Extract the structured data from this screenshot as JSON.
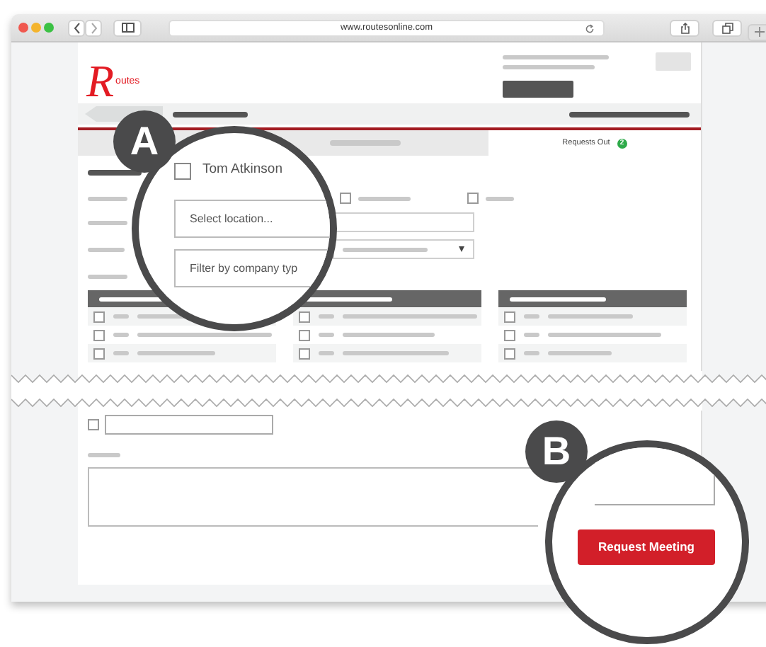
{
  "browser": {
    "url": "www.routesonline.com"
  },
  "header": {
    "logo": "Routes"
  },
  "tabs": [
    {
      "selected": false
    },
    {
      "label": "Requests Out",
      "badge": "2",
      "selected": true
    }
  ],
  "form": {
    "options": [
      {
        "checked": false
      },
      {
        "checked": false
      }
    ]
  },
  "tables": [
    {
      "rows": [
        {
          "checked": false
        },
        {
          "checked": false
        },
        {
          "checked": false
        }
      ]
    },
    {
      "rows": [
        {
          "checked": false
        },
        {
          "checked": false
        },
        {
          "checked": false
        }
      ]
    },
    {
      "rows": [
        {
          "checked": false
        },
        {
          "checked": false
        },
        {
          "checked": false
        }
      ]
    }
  ],
  "lower": {
    "option": {
      "checked": false
    }
  },
  "callouts": [
    {
      "letter": "A",
      "contact": {
        "label": "Tom Atkinson",
        "checked": false
      },
      "location_field": {
        "placeholder": "Select location..."
      },
      "company_filter": {
        "placeholder": "Filter by company typ"
      }
    },
    {
      "letter": "B",
      "button": "Request Meeting"
    }
  ]
}
